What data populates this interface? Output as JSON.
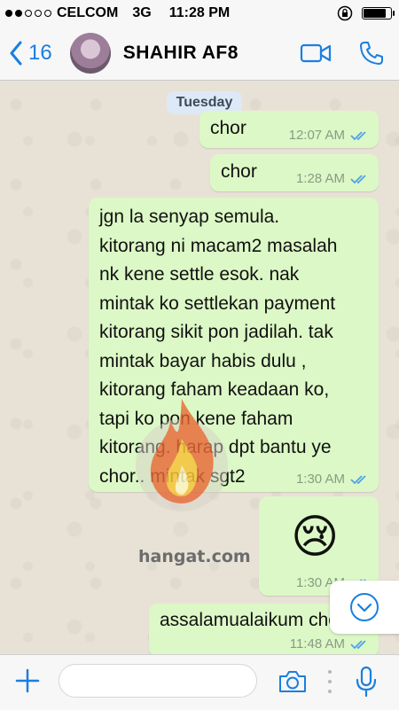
{
  "status_bar": {
    "carrier": "CELCOM",
    "network": "3G",
    "time": "11:28 PM",
    "signal_strength": 2,
    "battery_level": 0.9,
    "lock_icon": "orientation-lock-icon"
  },
  "header": {
    "back_count": "16",
    "contact_name": "SHAHIR AF8",
    "video_icon": "video-call-icon",
    "call_icon": "phone-call-icon",
    "accent_color": "#1a7fe0"
  },
  "chat": {
    "day_label": "Tuesday",
    "bubble_color": "#dcf8c6",
    "messages": [
      {
        "lines": [
          "chor"
        ],
        "time": "12:07 AM"
      },
      {
        "lines": [
          "chor"
        ],
        "time": "1:28 AM"
      },
      {
        "lines": [
          "jgn la senyap semula.",
          "kitorang ni macam2 masalah",
          "nk kene settle esok. nak",
          "mintak ko settlekan payment",
          "kitorang sikit pon jadilah. tak",
          "mintak bayar habis dulu ,",
          "kitorang faham keadaan ko,",
          "tapi ko pon kene faham",
          "kitorang. harap dpt bantu ye",
          "chor.. mintak sgt2"
        ],
        "time": "1:30 AM"
      },
      {
        "lines": [
          "😢"
        ],
        "time": "1:30 AM"
      },
      {
        "lines": [
          "assalamualaikum chor"
        ],
        "time": "11:48 AM"
      }
    ],
    "watermark": "hangat.com"
  },
  "composer": {
    "placeholder": "",
    "value": ""
  }
}
